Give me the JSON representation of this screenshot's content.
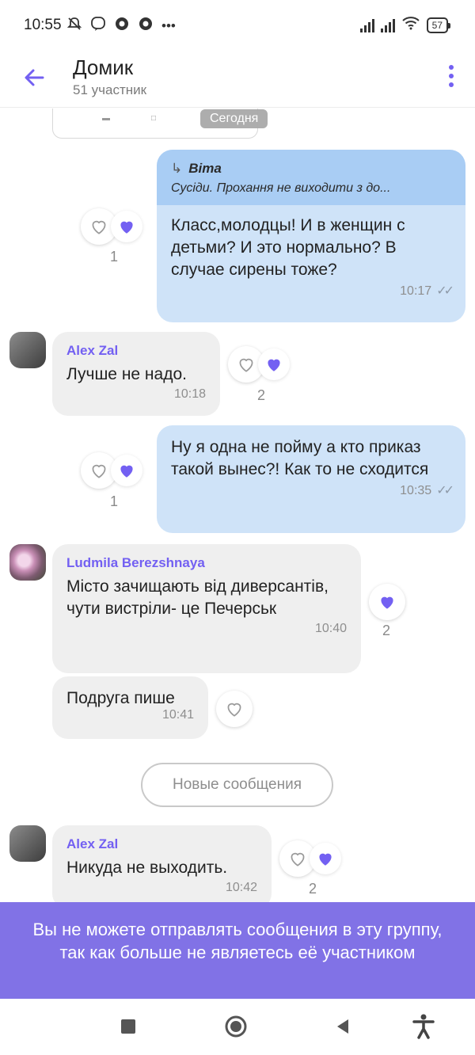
{
  "status_bar": {
    "time": "10:55",
    "left_icons": [
      "mute-icon",
      "viber-icon",
      "chrome-icon",
      "chrome-icon",
      "more-dots"
    ],
    "battery": "57"
  },
  "header": {
    "title": "Домик",
    "subtitle": "51 участник"
  },
  "chat": {
    "prev_image_date": "Сегодня",
    "messages": [
      {
        "direction": "out",
        "quote_author": "Віта",
        "quote_text": "Сусіди. Прохання не виходити з до...",
        "text": "Класс,молодцы! И в женщин с детьми? И это нормально? В случае сирены тоже?",
        "time": "10:17",
        "likes": "1"
      },
      {
        "direction": "in",
        "sender": "Alex Zal",
        "text": "Лучше не надо.",
        "time": "10:18",
        "likes": "2"
      },
      {
        "direction": "out",
        "text": "Ну я одна не пойму а кто приказ такой вынес?! Как то не сходится",
        "time": "10:35",
        "likes": "1"
      },
      {
        "direction": "in",
        "sender": "Ludmila Berezshnaya",
        "text": "Місто зачищають від диверсантів, чути вистріли- це Печерськ",
        "time": "10:40",
        "likes": "2"
      },
      {
        "direction": "in",
        "text": "Подруга пише",
        "time": "10:41"
      },
      {
        "direction": "in",
        "sender": "Alex Zal",
        "text": "Никуда не выходить.",
        "time": "10:42",
        "likes": "2"
      }
    ],
    "new_messages_label": "Новые сообщения"
  },
  "banner": {
    "text": "Вы не можете отправлять сообщения в эту группу, так как больше не являетесь её участником"
  },
  "colors": {
    "accent": "#7360f2",
    "outgoing_bubble": "#cfe3f8",
    "incoming_bubble": "#efefef",
    "quote_bg": "#a9cdf4",
    "banner_bg": "#8172e6"
  }
}
